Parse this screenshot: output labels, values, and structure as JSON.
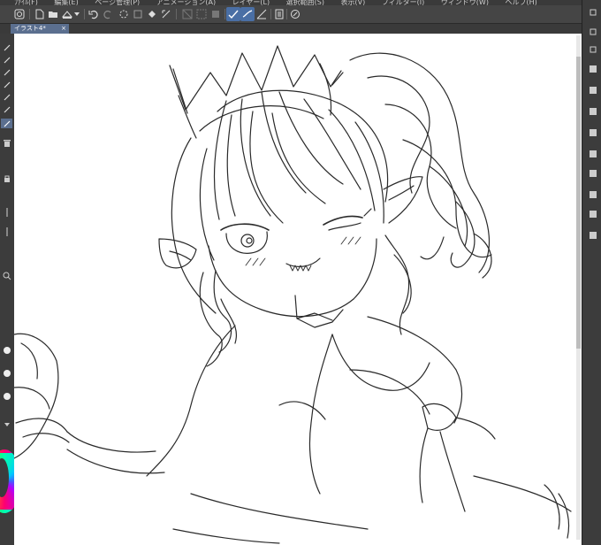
{
  "app": {
    "window": "clip-studio-paint"
  },
  "menubar": {
    "items": [
      "ﾌｧｲﾙ(F)",
      "編集(E)",
      "ページ管理(P)",
      "アニメーション(A)",
      "レイヤー(L)",
      "選択範囲(S)",
      "表示(V)",
      "フィルター(I)",
      "ウィンドウ(W)",
      "ヘルプ(H)"
    ]
  },
  "document_tab": {
    "title": "イラスト4*",
    "close": "×"
  },
  "colors": {
    "toolbar_bg": "#454545",
    "active_tool": "#4a6fa5",
    "tab_active": "#5b6f8f",
    "canvas": "#ffffff",
    "sketch_stroke": "#2a2a2a"
  },
  "toolbar": {
    "tools": [
      "app-icon",
      "new-file-icon",
      "open-folder-icon",
      "save-icon",
      "dropdown-icon",
      "undo-icon",
      "redo-icon",
      "loading-icon",
      "clear-icon",
      "fill-icon",
      "transform-icon",
      "deselect-icon",
      "invert-selection-icon",
      "border-icon",
      "check-icon",
      "check-alt-icon",
      "ruler-icon",
      "layer-menu-icon",
      "rotate-icon"
    ]
  }
}
